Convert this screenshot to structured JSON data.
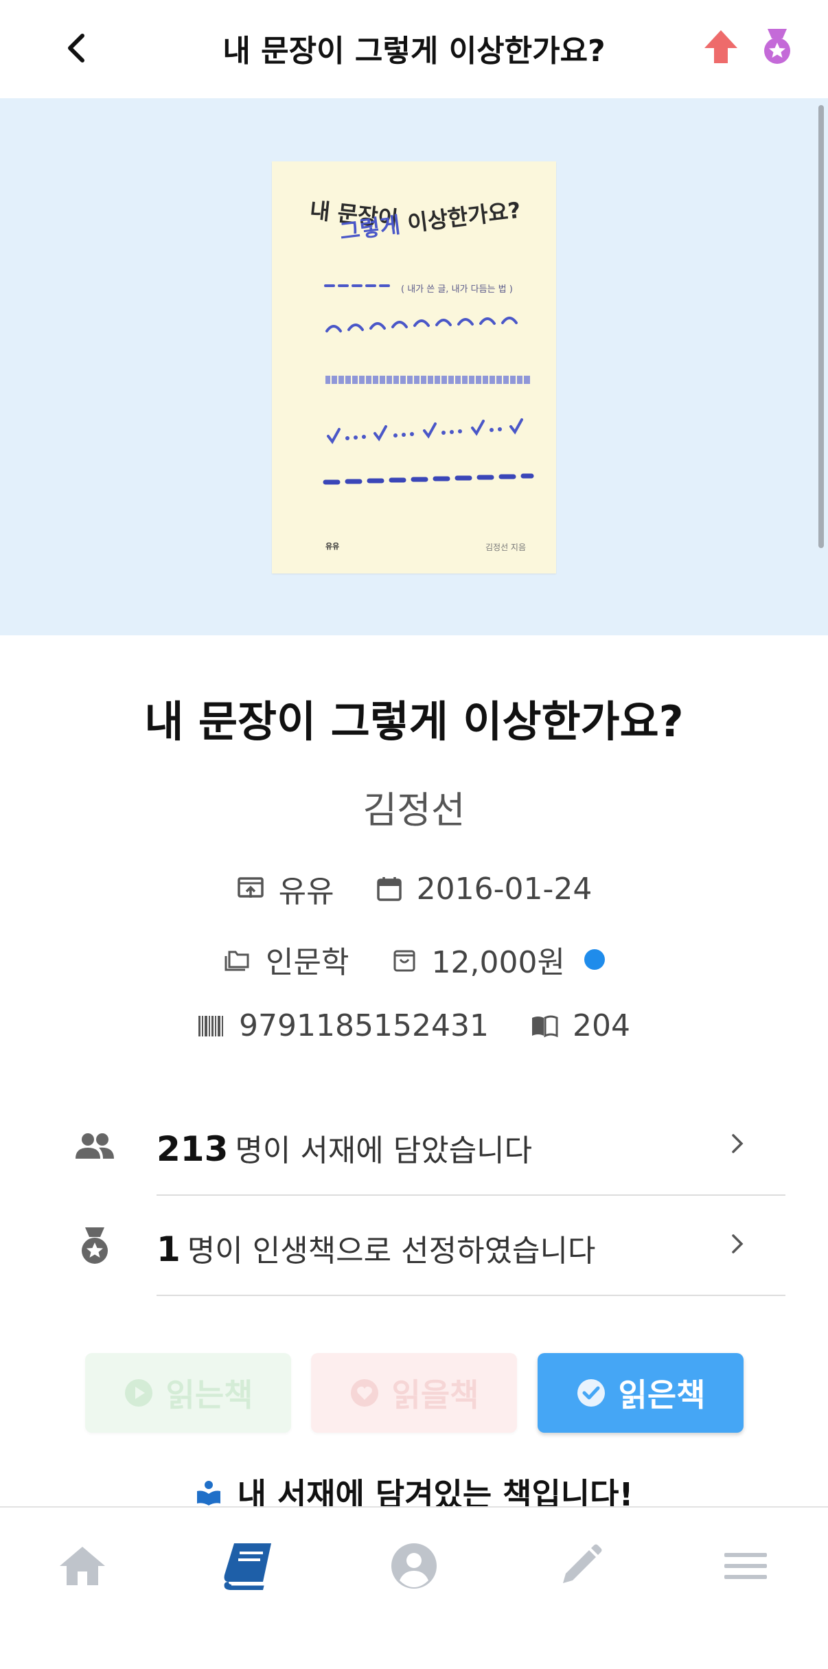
{
  "header": {
    "title": "내 문장이 그렇게 이상한가요?",
    "back_icon": "chevron-left-icon",
    "share_icon": "arrow-up-icon",
    "medal_icon": "medal-icon",
    "accent_up": "#ee6b6b",
    "accent_medal": "#c46ad8"
  },
  "cover": {
    "line1": "내 문장이",
    "line2_highlight": "그렇게",
    "line2_rest": " 이상한가요?",
    "subtitle": "( 내가 쓴 글, 내가 다듬는 법 )",
    "author": "김정선 지음",
    "publisher": "유유",
    "background": "#e3f0fb"
  },
  "book": {
    "title": "내 문장이 그렇게 이상한가요?",
    "author": "김정선",
    "publisher": "유유",
    "date": "2016-01-24",
    "category": "인문학",
    "price": "12,000원",
    "isbn": "9791185152431",
    "pages": "204"
  },
  "stats": {
    "shelf_count": "213",
    "shelf_text": "명이 서재에 담았습니다",
    "life_count": "1",
    "life_text": "명이 인생책으로 선정하였습니다"
  },
  "buttons": {
    "reading": "읽는책",
    "to_read": "읽을책",
    "read": "읽은책",
    "read_color": "#45a6f5"
  },
  "shelf_note": "내 서재에 담겨있는 책입니다!",
  "nav": {
    "items": [
      "home-icon",
      "book-icon",
      "profile-icon",
      "pencil-icon",
      "menu-icon"
    ],
    "active": "book-icon",
    "active_color": "#1e5fa8"
  }
}
